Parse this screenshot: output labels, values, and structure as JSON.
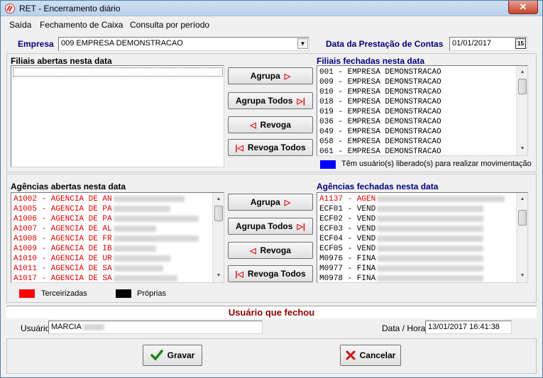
{
  "window": {
    "title": "RET - Encerramento diário",
    "close_label": "✕"
  },
  "menu": [
    "Saída",
    "Fechamento de Caixa",
    "Consulta por período"
  ],
  "empresa": {
    "label": "Empresa",
    "value": "009 EMPRESA DEMONSTRACAO"
  },
  "data_prestacao": {
    "label": "Data da Prestação de Contas",
    "value": "01/01/2017",
    "calendar_day": "15"
  },
  "filiais_abertas": {
    "label": "Filiais abertas nesta data",
    "items": []
  },
  "filiais_fechadas": {
    "label": "Filiais fechadas nesta data",
    "items": [
      "001 - EMPRESA DEMONSTRACAO",
      "009 - EMPRESA DEMONSTRACAO",
      "010 - EMPRESA DEMONSTRACAO",
      "018 - EMPRESA DEMONSTRACAO",
      "019 - EMPRESA DEMONSTRACAO",
      "036 - EMPRESA DEMONSTRACAO",
      "049 - EMPRESA DEMONSTRACAO",
      "058 - EMPRESA DEMONSTRACAO",
      "061 - EMPRESA DEMONSTRACAO"
    ]
  },
  "buttons_top": {
    "agrupa": "Agrupa",
    "agrupa_todos": "Agrupa Todos",
    "revoga": "Revoga",
    "revoga_todos": "Revoga Todos"
  },
  "legend_top": {
    "color": "#0000ff",
    "text": "Têm usuário(s) liberado(s) para realizar movimentação"
  },
  "agencias_abertas": {
    "label": "Agências abertas nesta data",
    "items": [
      "A1002 - AGENCIA DE AN",
      "A1005 - AGENCIA DE PA",
      "A1006 - AGENCIA DE PA",
      "A1007 - AGENCIA DE AL",
      "A1008 - AGENCIA DE FR",
      "A1009 - AGENCIA DE IB",
      "A1010 - AGENCIA DE UR",
      "A1011 - AGENCIA DE SA",
      "A1017 - AGENCIA DE SA"
    ]
  },
  "agencias_fechadas": {
    "label": "Agências fechadas nesta data",
    "items": [
      {
        "text": "A1137 - AGEN",
        "color": "#e00000"
      },
      {
        "text": "ECF01 - VEND",
        "color": "#000000"
      },
      {
        "text": "ECF02 - VEND",
        "color": "#000000"
      },
      {
        "text": "ECF03 - VEND",
        "color": "#000000"
      },
      {
        "text": "ECF04 - VEND",
        "color": "#000000"
      },
      {
        "text": "ECF05 - VEND",
        "color": "#000000"
      },
      {
        "text": "M0976 - FINA",
        "color": "#000000"
      },
      {
        "text": "M0977 - FINA",
        "color": "#000000"
      },
      {
        "text": "M0978 - FINA",
        "color": "#000000"
      }
    ]
  },
  "buttons_mid": {
    "agrupa": "Agrupa",
    "agrupa_todos": "Agrupa Todos",
    "revoga": "Revoga",
    "revoga_todos": "Revoga Todos"
  },
  "legend_bottom": {
    "terceirizadas": {
      "color": "#ff0000",
      "text": "Terceirizadas"
    },
    "proprias": {
      "color": "#000000",
      "text": "Próprias"
    }
  },
  "usuario_section": {
    "title": "Usuário que fechou",
    "usuario_label": "Usuário",
    "usuario_value": "MARCIA",
    "datahora_label": "Data / Hora",
    "datahora_value": "13/01/2017 16:41:38"
  },
  "actions": {
    "gravar": "Gravar",
    "cancelar": "Cancelar"
  }
}
